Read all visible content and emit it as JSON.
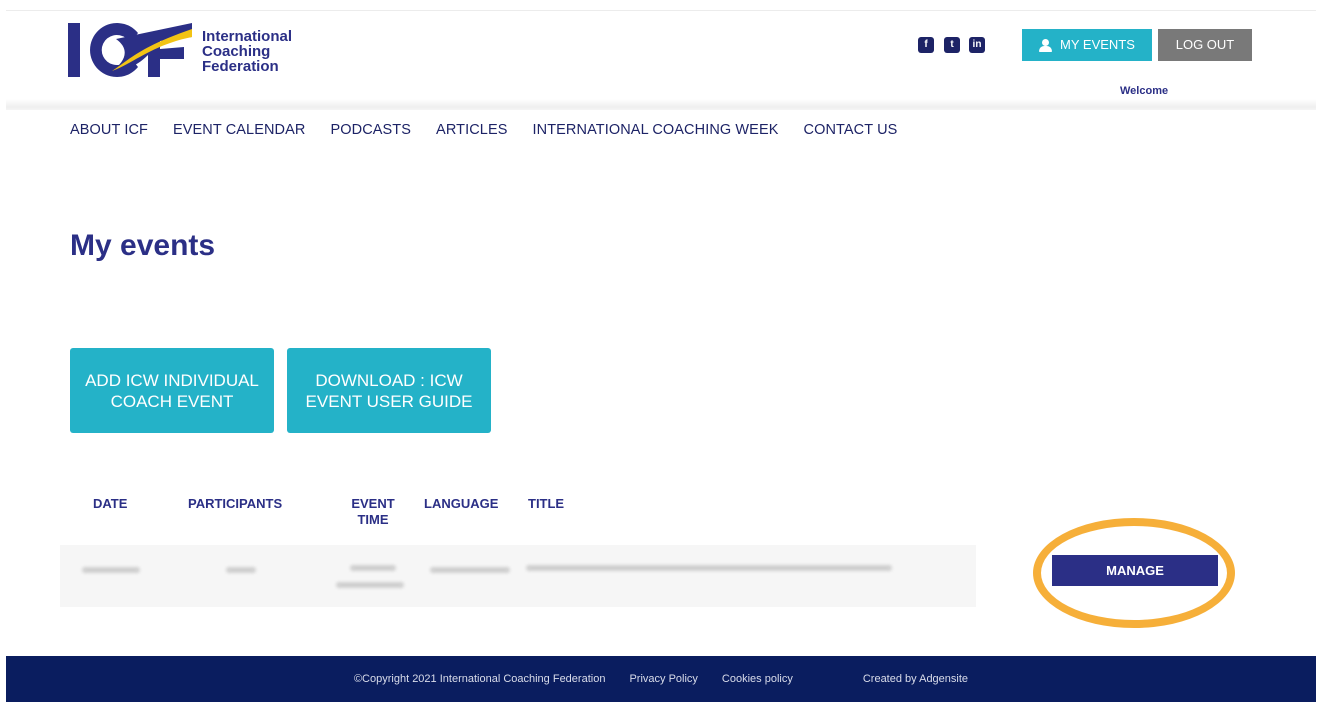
{
  "header": {
    "logo": {
      "mark": "ICF",
      "line1": "International",
      "line2": "Coaching",
      "line3": "Federation"
    },
    "social": [
      {
        "icon": "facebook-icon",
        "glyph": "f"
      },
      {
        "icon": "twitter-icon",
        "glyph": "t"
      },
      {
        "icon": "linkedin-icon",
        "glyph": "in"
      }
    ],
    "my_events_label": "MY EVENTS",
    "logout_label": "LOG OUT",
    "welcome": "Welcome"
  },
  "nav": [
    "ABOUT ICF",
    "EVENT CALENDAR",
    "PODCASTS",
    "ARTICLES",
    "INTERNATIONAL COACHING WEEK",
    "CONTACT US"
  ],
  "main": {
    "title": "My events",
    "add_button": "ADD ICW INDIVIDUAL COACH EVENT",
    "download_button": "DOWNLOAD : ICW EVENT USER GUIDE",
    "table": {
      "headers": {
        "date": "DATE",
        "participants": "PARTICIPANTS",
        "event_time": "EVENT TIME",
        "language": "LANGUAGE",
        "title": "TITLE"
      }
    },
    "manage_label": "MANAGE"
  },
  "footer": {
    "copyright": "©Copyright 2021 International Coaching Federation",
    "privacy": "Privacy Policy",
    "cookies": "Cookies policy",
    "created": "Created by Adgensite"
  },
  "colors": {
    "navy": "#2b2f86",
    "teal": "#24b2c8",
    "grey_button": "#797979",
    "footer": "#0a1d5f",
    "highlight": "#f5a623"
  }
}
